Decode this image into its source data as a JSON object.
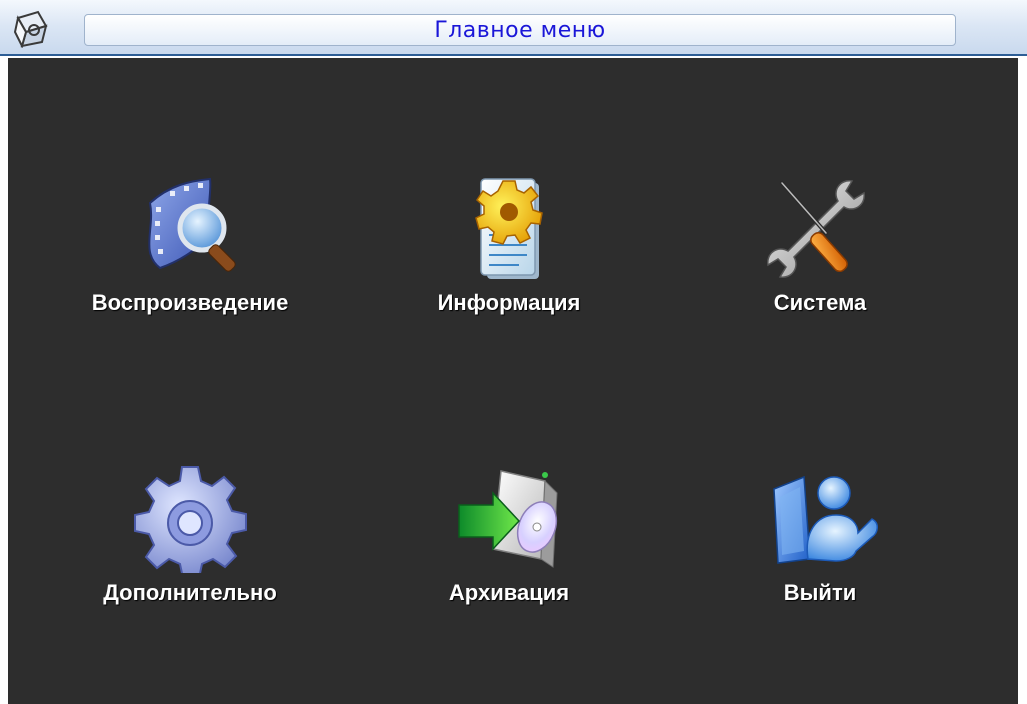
{
  "window": {
    "title": "Главное меню"
  },
  "menu": {
    "items": [
      {
        "label": "Воспроизведение",
        "icon": "film-search-icon"
      },
      {
        "label": "Информация",
        "icon": "info-document-gear-icon"
      },
      {
        "label": "Система",
        "icon": "wrench-screwdriver-icon"
      },
      {
        "label": "Дополнительно",
        "icon": "gear-icon"
      },
      {
        "label": "Архивация",
        "icon": "backup-disc-icon"
      },
      {
        "label": "Выйти",
        "icon": "logout-user-icon"
      }
    ]
  },
  "colors": {
    "title_text": "#1a16d8",
    "background": "#2d2d2d",
    "label_text": "#ffffff"
  }
}
